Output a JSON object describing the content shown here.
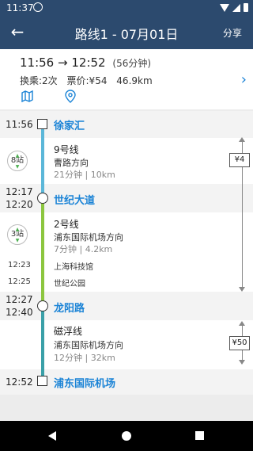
{
  "status_bar": {
    "time": "11:37"
  },
  "app_bar": {
    "back_icon": "arrow-left-icon",
    "title": "路线1 - 07月01日",
    "share_label": "分享"
  },
  "summary": {
    "depart_time": "11:56",
    "arrow": "→",
    "arrive_time": "12:52",
    "duration": "(56分钟)",
    "transfers": "换乘:2次",
    "fare": "票价:¥54",
    "distance": "46.9km",
    "icons": [
      "map-icon",
      "location-pin-icon",
      "chevron-right-icon"
    ]
  },
  "stations": [
    {
      "times": [
        "11:56"
      ],
      "name": "徐家汇",
      "node": "square"
    },
    {
      "times": [
        "12:17",
        "12:20"
      ],
      "name": "世纪大道",
      "node": "circle"
    },
    {
      "times": [
        "12:27",
        "12:40"
      ],
      "name": "龙阳路",
      "node": "circle"
    },
    {
      "times": [
        "12:52"
      ],
      "name": "浦东国际机场",
      "node": "square"
    }
  ],
  "legs": [
    {
      "stops": "8站",
      "line": "9号线",
      "direction": "曹路方向",
      "meta": "21分钟 | 10km",
      "color": "#5bb7d9",
      "intermediate": []
    },
    {
      "stops": "3站",
      "line": "2号线",
      "direction": "浦东国际机场方向",
      "meta": "7分钟 | 4.2km",
      "color": "#8cc63f",
      "intermediate": [
        {
          "time": "12:23",
          "name": "上海科技馆"
        },
        {
          "time": "12:25",
          "name": "世纪公园"
        }
      ]
    },
    {
      "stops": "",
      "line": "磁浮线",
      "direction": "浦东国际机场方向",
      "meta": "12分钟 | 32km",
      "color": "#3aa0a8",
      "intermediate": []
    }
  ],
  "fares": [
    {
      "label": "¥4"
    },
    {
      "label": "¥50"
    }
  ],
  "nav_bar": {
    "icons": [
      "back-triangle-icon",
      "home-circle-icon",
      "recents-square-icon"
    ]
  }
}
